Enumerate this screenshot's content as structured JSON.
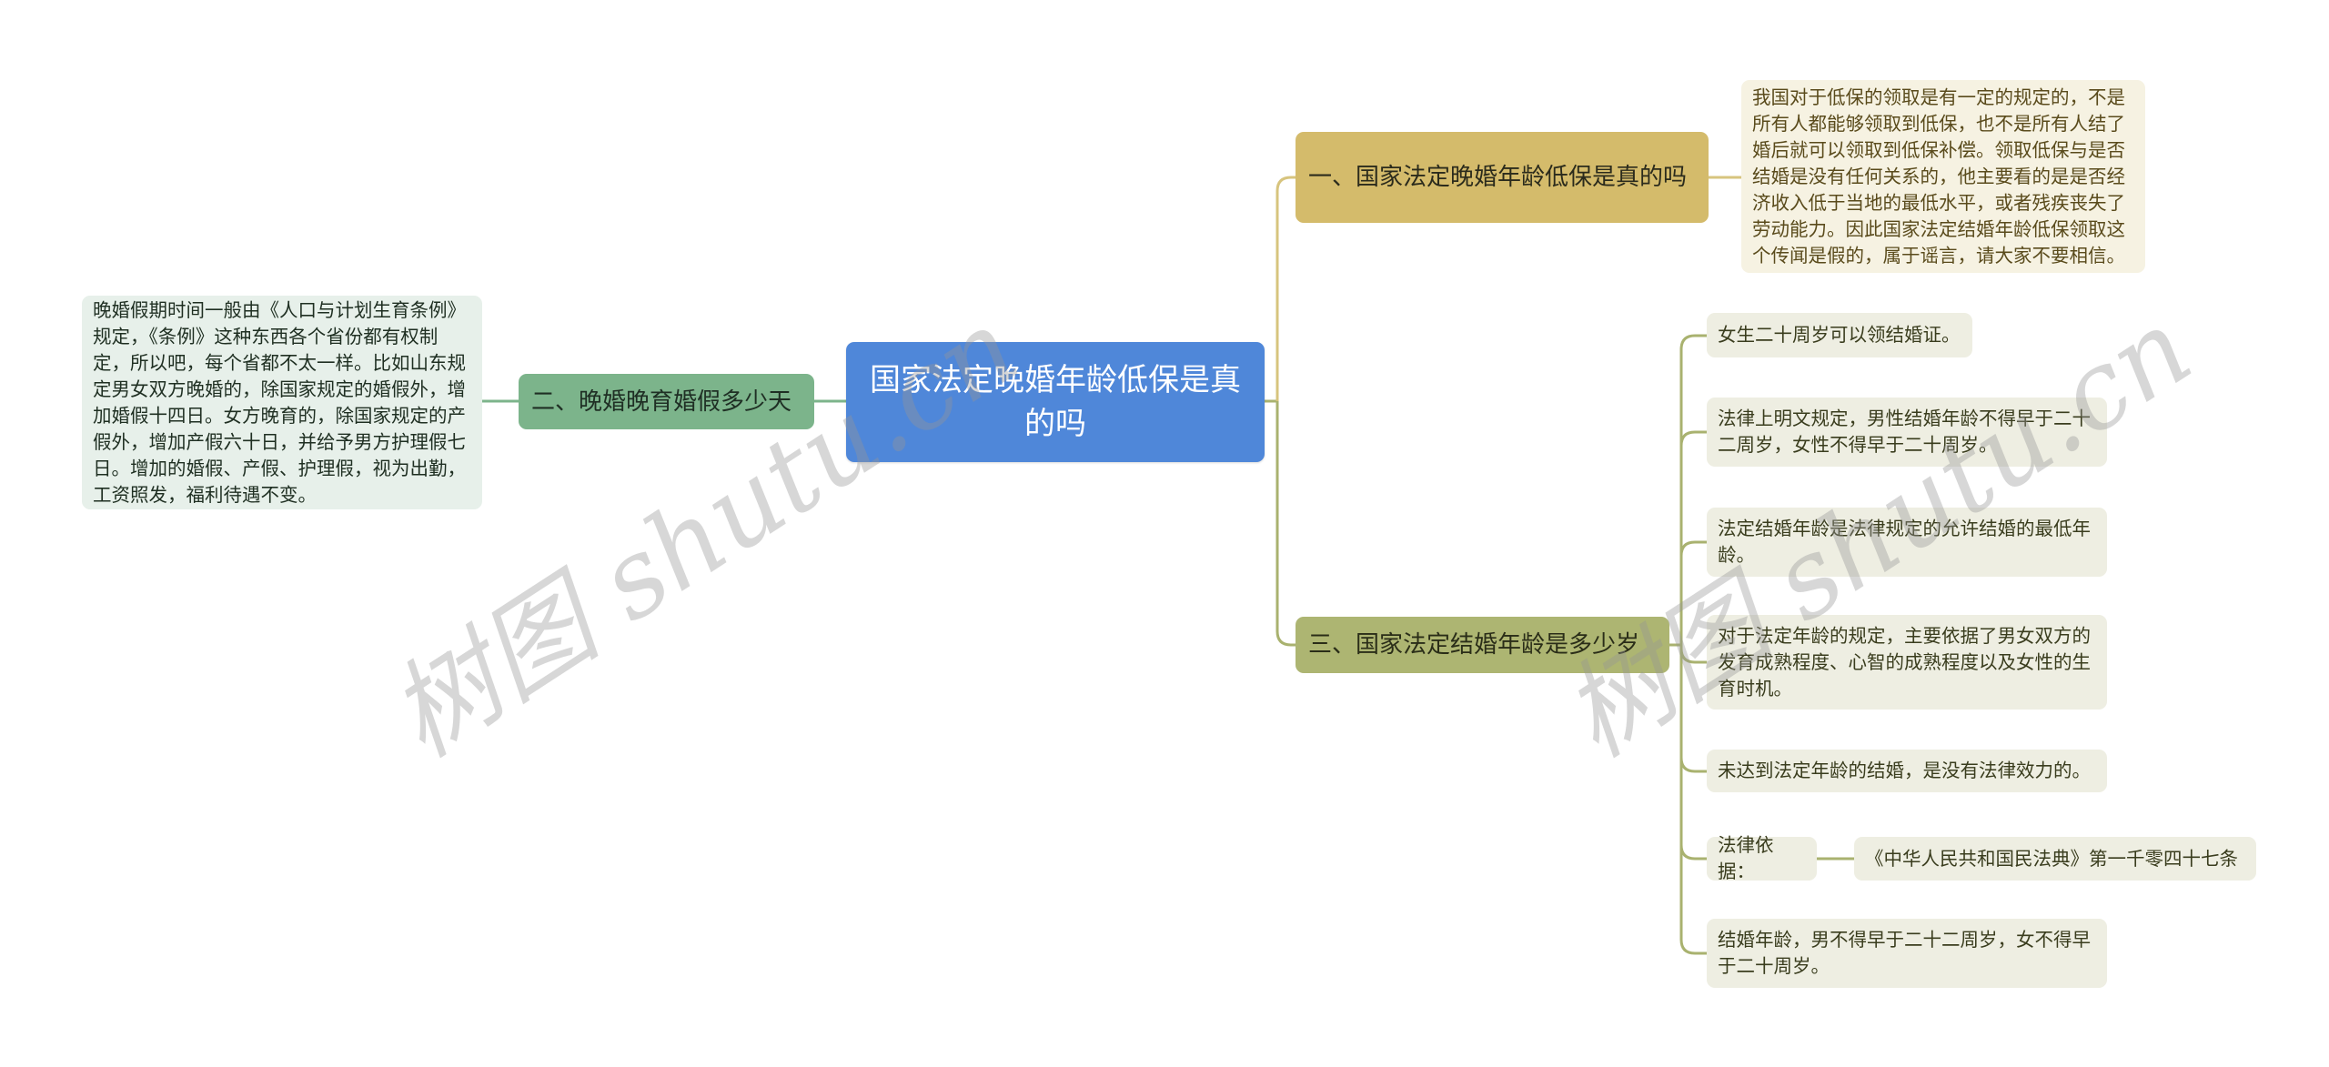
{
  "mindmap": {
    "root": {
      "label": "国家法定晚婚年龄低保是真的吗"
    },
    "branches": [
      {
        "label": "一、国家法定晚婚年龄低保是真的吗",
        "color": "#d4bb6b",
        "children": [
          {
            "text": "我国对于低保的领取是有一定的规定的，不是所有人都能够领取到低保，也不是所有人结了婚后就可以领取到低保补偿。领取低保与是否结婚是没有任何关系的，他主要看的是是否经济收入低于当地的最低水平，或者残疾丧失了劳动能力。因此国家法定结婚年龄低保领取这个传闻是假的，属于谣言，请大家不要相信。"
          }
        ]
      },
      {
        "label": "二、晚婚晚育婚假多少天",
        "color": "#7cb48b",
        "children": [
          {
            "text": "晚婚假期时间一般由《人口与计划生育条例》规定，《条例》这种东西各个省份都有权制定，所以吧，每个省都不太一样。比如山东规定男女双方晚婚的，除国家规定的婚假外，增加婚假十四日。女方晚育的，除国家规定的产假外，增加产假六十日，并给予男方护理假七日。增加的婚假、产假、护理假，视为出勤，工资照发，福利待遇不变。"
          }
        ]
      },
      {
        "label": "三、国家法定结婚年龄是多少岁",
        "color": "#adb572",
        "children": [
          {
            "text": "女生二十周岁可以领结婚证。"
          },
          {
            "text": "法律上明文规定，男性结婚年龄不得早于二十二周岁，女性不得早于二十周岁。"
          },
          {
            "text": "法定结婚年龄是法律规定的允许结婚的最低年龄。"
          },
          {
            "text": "对于法定年龄的规定，主要依据了男女双方的发育成熟程度、心智的成熟程度以及女性的生育时机。"
          },
          {
            "text": "未达到法定年龄的结婚，是没有法律效力的。"
          },
          {
            "text": "法律依据：",
            "children": [
              {
                "text": "《中华人民共和国民法典》第一千零四十七条"
              }
            ]
          },
          {
            "text": "结婚年龄，男不得早于二十二周岁，女不得早于二十周岁。"
          }
        ]
      }
    ]
  },
  "watermark": {
    "text": "树图 shutu.cn"
  },
  "colors": {
    "root": "#4f87d9",
    "link_gold": "#d7c47e",
    "link_green": "#7cb48b",
    "link_olive": "#a9b26f"
  }
}
